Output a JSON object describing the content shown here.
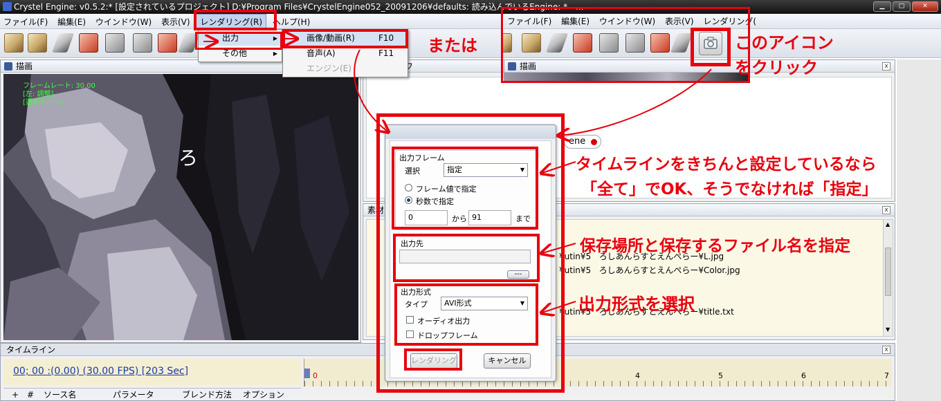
{
  "window": {
    "title": "Crystel Engine:  v0.5.2:* [設定されているプロジェクト] D:¥Program Files¥CrystelEngine052_20091206¥defaults: 読み込んでいるEngine: * - ...",
    "minimize_label": "▁",
    "maximize_label": "□",
    "close_label": "✕"
  },
  "menubar": {
    "items": [
      "ファイル(F)",
      "編集(E)",
      "ウインドウ(W)",
      "表示(V)",
      "レンダリング(R)",
      "ヘルプ(H)"
    ]
  },
  "menubar_right": {
    "items": [
      "ファイル(F)",
      "編集(E)",
      "ウインドウ(W)",
      "表示(V)",
      "レンダリング("
    ]
  },
  "menu_level1": {
    "items": [
      {
        "label": "出力",
        "arrow": "▶"
      },
      {
        "label": "その他",
        "arrow": "▶"
      }
    ]
  },
  "menu_level2": {
    "items": [
      {
        "label": "画像/動画(R)",
        "shortcut": "F10"
      },
      {
        "label": "音声(A)",
        "shortcut": "F11"
      },
      {
        "label": "エンジン(E)",
        "shortcut": ""
      }
    ]
  },
  "panels": {
    "draw": {
      "title": "描画"
    },
    "draw_right": {
      "title": "描画"
    },
    "top_right": {
      "title": "フ"
    },
    "materials": {
      "title": "素材"
    },
    "timeline": {
      "title": "タイムライン"
    }
  },
  "draw_overlay": {
    "lines": [
      "フレームレート: 30.00",
      "[左: 調整]",
      "[選択モード]"
    ],
    "handwritten_char": "ろ"
  },
  "scene_tag": {
    "label": "ene"
  },
  "files": [
    {
      "path": "¥utin¥5",
      "name": "ろしあんらすとえんぺらー¥L.jpg"
    },
    {
      "path": "¥utin¥5",
      "name": "ろしあんらすとえんぺらー¥Color.jpg"
    },
    {
      "path": "¥utin¥5",
      "name": "ろしあんらすとえんぺらー¥title.txt"
    }
  ],
  "dialog": {
    "frame_group": "出力フレーム",
    "select_label": "選択",
    "select_value": "指定",
    "radio_frame": "フレーム値で指定",
    "radio_seconds": "秒数で指定",
    "from_value": "0",
    "from_label": "から",
    "to_value": "91",
    "to_label": "まで",
    "dest_group": "出力先",
    "browse_label": "---",
    "format_group": "出力形式",
    "type_label": "タイプ",
    "type_value": "AVI形式",
    "audio_label": "オーディオ出力",
    "dropframe_label": "ドロップフレーム",
    "render_button": "レンダリング",
    "cancel_button": "キャンセル"
  },
  "timeline": {
    "time_readout": "00; 00 :(0.00) (30.00 FPS) [203 Sec]",
    "ruler_ticks": [
      "0",
      "4",
      "5",
      "6",
      "7"
    ],
    "columns": [
      "+",
      "#",
      "ソース名",
      "パラメータ",
      "ブレンド方法",
      "オプション"
    ]
  },
  "annotations": {
    "or": "または",
    "click_icon_line1": "このアイコン",
    "click_icon_line2": "をクリック",
    "frame_note_line1": "タイムラインをきちんと設定しているなら",
    "frame_note_line2": "「全て」でOK、そうでなければ「指定」",
    "dest_note": "保存場所と保存するファイル名を指定",
    "format_note": "出力形式を選択"
  },
  "colors": {
    "annotation_red": "#e8000d",
    "overlay_green": "#3cff3c",
    "timeline_blue": "#1a3aa8"
  }
}
